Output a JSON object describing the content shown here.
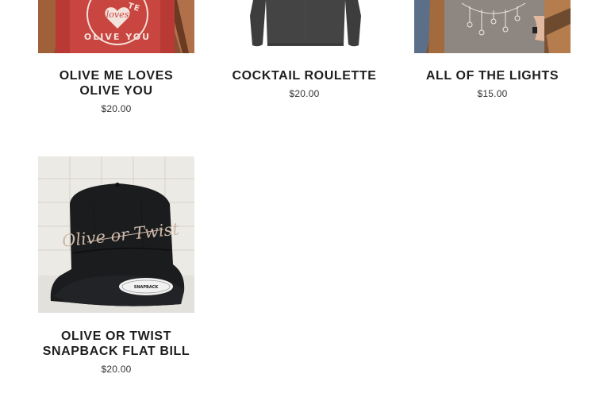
{
  "products": [
    {
      "title": "OLIVE ME LOVES OLIVE YOU",
      "price": "$20.00",
      "image_text": "loves"
    },
    {
      "title": "COCKTAIL ROULETTE",
      "price": "$20.00"
    },
    {
      "title": "ALL OF THE LIGHTS",
      "price": "$15.00"
    },
    {
      "title": "OLIVE OR TWIST SNAPBACK FLAT BILL",
      "price": "$20.00",
      "image_text": "Olive or Twist",
      "sticker_text": "SNAPBACK"
    }
  ],
  "colors": {
    "shirt_red": "#c9453f",
    "shirt_charcoal": "#3d3d3d",
    "shirt_gray": "#8e8680",
    "wood": "#9a5a33",
    "cap_black": "#1b1c1e",
    "cap_embroidery": "#cdb8a8",
    "tile_wall": "#eceae4"
  }
}
